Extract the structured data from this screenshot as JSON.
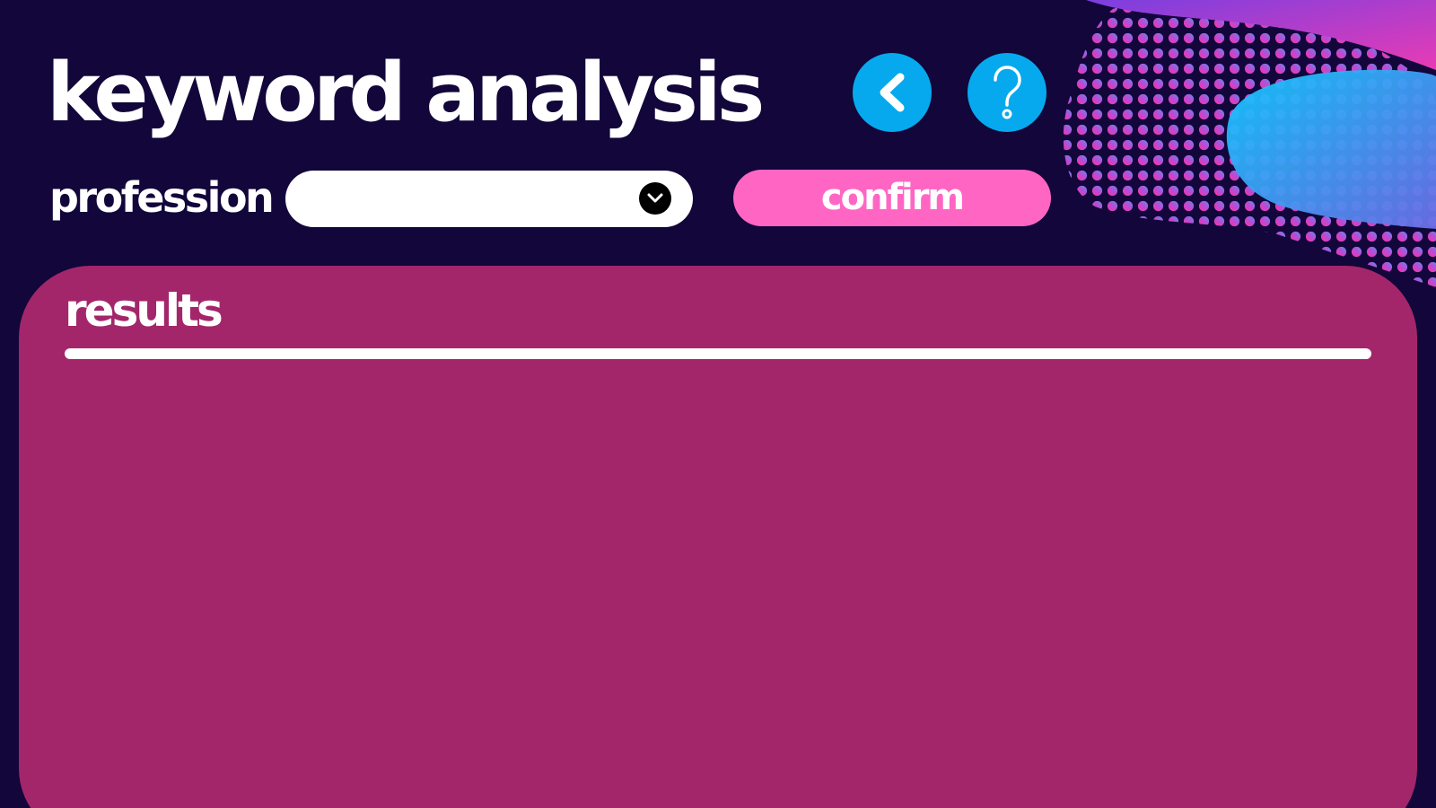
{
  "header": {
    "title": "keyword analysis"
  },
  "nav": {
    "back_icon": "chevron-left-icon",
    "help_icon": "question-mark-icon"
  },
  "form": {
    "profession_label": "profession",
    "profession_select": {
      "value": "",
      "icon": "chevron-down-icon"
    },
    "confirm_label": "confirm"
  },
  "results": {
    "title": "results"
  },
  "colors": {
    "background": "#12063a",
    "accent_blue": "#06a9ee",
    "confirm_pink": "#ff66c4",
    "results_panel": "#a3266b",
    "text": "#ffffff"
  }
}
